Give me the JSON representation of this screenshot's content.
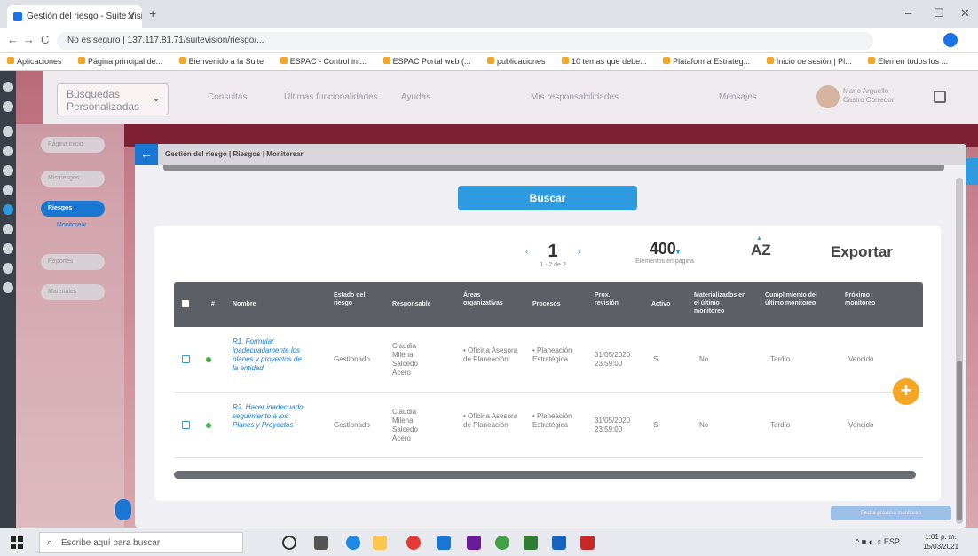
{
  "browser": {
    "tab_title": "Gestión del riesgo - Suite Vision",
    "close_glyph": "✕",
    "new_tab_glyph": "+",
    "url": "No es seguro | 137.117.81.71/suitevision/riesgo/...",
    "controls": {
      "back": "←",
      "forward": "→",
      "reload": "C",
      "minimize": "–",
      "maximize": "☐",
      "close": "✕"
    },
    "bookmarks": [
      "Aplicaciones",
      "Página principal de...",
      "Bienvenido a la Suite",
      "ESPAC - Control int...",
      "ESPAC Portal web (...",
      "publicaciones",
      "10 temas que debe...",
      "Plataforma Estrateg...",
      "Inicio de sesión | Pl...",
      "Elemen todos los ..."
    ]
  },
  "app": {
    "search_select": {
      "label": "Búsquedas Personalizadas",
      "chevron": "⌄"
    },
    "top_menu": [
      "Consultas",
      "Últimas funcionalidades",
      "Ayudas",
      "Mis responsabilidades",
      "Mensajes"
    ],
    "user": {
      "name": "Mario Arguello Castro Corredor"
    },
    "sidebar": {
      "items": [
        "Página inicio",
        "Mis riesgos",
        "Riesgos",
        "Reportes",
        "Materiales"
      ],
      "sublink": "Monitorear"
    },
    "breadcrumb": "Gestión del riesgo | Riesgos | Monitorear",
    "back_glyph": "←",
    "buscar_label": "Buscar",
    "pager": {
      "page": "1",
      "range": "1 - 2 de 2",
      "prev": "‹",
      "next": "›"
    },
    "per_page": {
      "value": "400",
      "caret": "▾",
      "label": "Elementos en página"
    },
    "sort": {
      "label": "AZ",
      "indicator": "▲"
    },
    "export_label": "Exportar",
    "table": {
      "headers": [
        "#",
        "Nombre",
        "Estado del riesgo",
        "Responsable",
        "Áreas organizativas",
        "Procesos",
        "Prox. revisión",
        "Activo",
        "Materializados en el último monitoreo",
        "Cumplimiento del último monitoreo",
        "Próximo monitoreo"
      ],
      "rows": [
        {
          "nombre": "R1. Formular inadecuadamente los planes y proyectos de la entidad",
          "estado": "Gestionado",
          "responsable": "Claudia Milena Salcedo Acero",
          "areas": "• Oficina Asesora de Planeación",
          "procesos": "• Planeación Estratégica",
          "revision": "31/05/2020 23:59:00",
          "activo": "Sí",
          "materializados": "No",
          "cumplimiento": "Tardío",
          "proximo": "Vencido"
        },
        {
          "nombre": "R2. Hacer inadecuado seguimiento a los Planes y Proyectos",
          "estado": "Gestionado",
          "responsable": "Claudia Milena Salcedo Acero",
          "areas": "• Oficina Asesora de Planeación",
          "procesos": "• Planeación Estratégica",
          "revision": "31/05/2020 23:59:00",
          "activo": "Sí",
          "materializados": "No",
          "cumplimiento": "Tardío",
          "proximo": "Vencido"
        }
      ]
    },
    "fab_glyph": "+",
    "ghost_button": "Fecha próximo monitoreo"
  },
  "taskbar": {
    "search_placeholder": "Escribe aquí para buscar",
    "search_glyph": "⌕",
    "tray": "^ ■ ◐ ♫ ESP",
    "time": "1:01 p. m.",
    "date": "15/03/2021"
  },
  "colors": {
    "accent": "#2e9be0",
    "header": "#5c5f66",
    "fab": "#f5a623",
    "status_dot": "#3cb043"
  }
}
